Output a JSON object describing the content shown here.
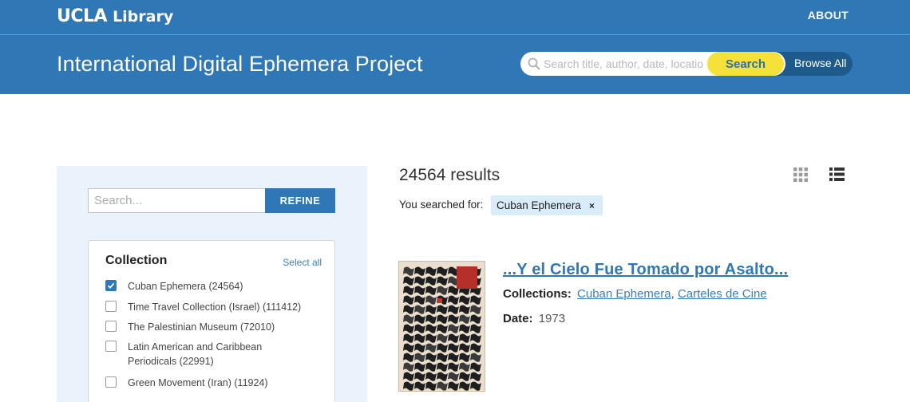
{
  "header": {
    "logo_ucla": "UCLA",
    "logo_library": "Library",
    "about_label": "ABOUT",
    "project_title": "International Digital Ephemera Project",
    "search_placeholder": "Search title, author, date, location",
    "search_button": "Search",
    "browse_all": "Browse All",
    "brand_color": "#2f78b5",
    "search_button_color": "#f4e23a"
  },
  "sidebar": {
    "search_placeholder": "Search...",
    "refine_button": "REFINE",
    "collection": {
      "title": "Collection",
      "select_all": "Select all",
      "items": [
        {
          "label": "Cuban Ephemera (24564)",
          "checked": true
        },
        {
          "label": "Time Travel Collection (Israel) (111412)",
          "checked": false
        },
        {
          "label": "The Palestinian Museum (72010)",
          "checked": false
        },
        {
          "label": "Latin American and Caribbean Periodicals (22991)",
          "checked": false
        },
        {
          "label": "Green Movement (Iran) (11924)",
          "checked": false
        }
      ]
    }
  },
  "results": {
    "count_text": "24564 results",
    "searched_label": "You searched for:",
    "filter_chip": "Cuban Ephemera",
    "chip_close": "×",
    "items": [
      {
        "title": "...Y el Cielo Fue Tomado por Asalto...",
        "collections_label": "Collections:",
        "collections": [
          "Cuban Ephemera",
          "Carteles de Cine"
        ],
        "date_label": "Date:",
        "date": "1973"
      }
    ]
  }
}
